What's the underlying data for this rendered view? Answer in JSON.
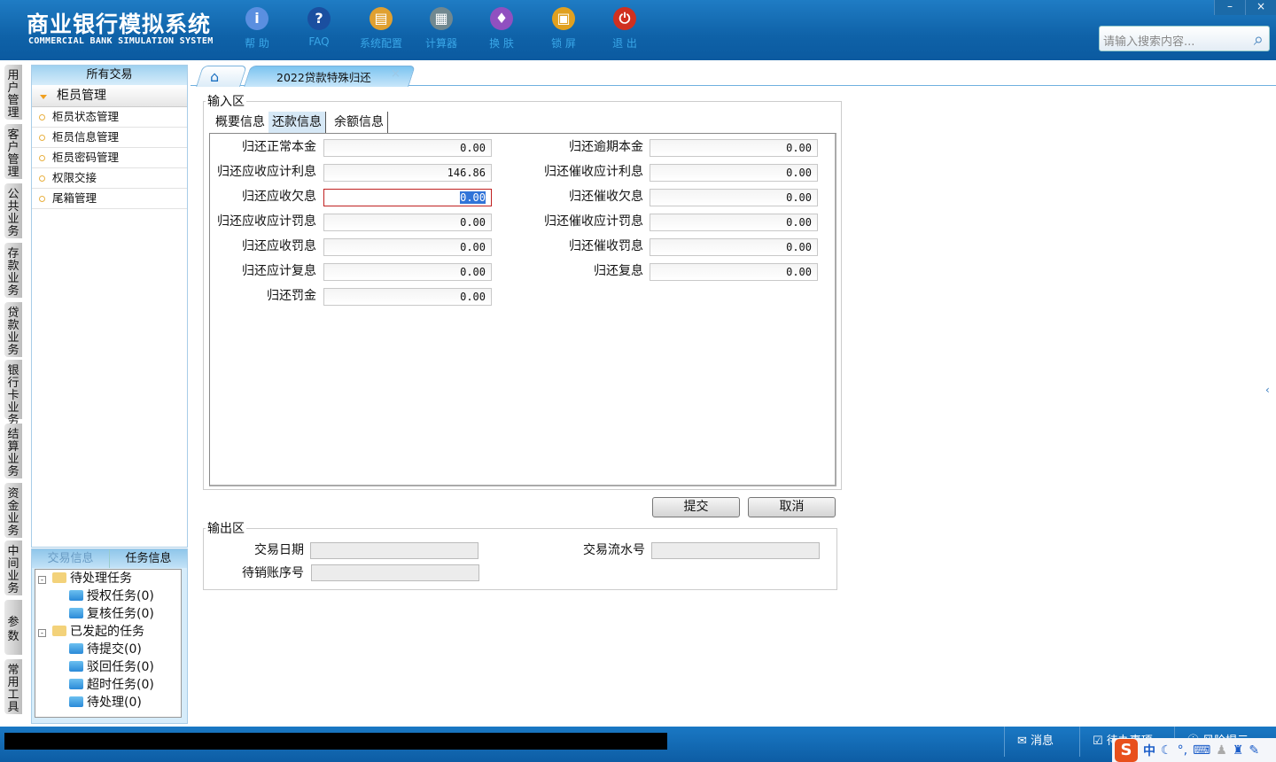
{
  "header": {
    "title": "商业银行模拟系统",
    "subtitle": "COMMERCIAL BANK SIMULATION SYSTEM",
    "tools": [
      {
        "label": "帮 助",
        "icon": "info-icon",
        "color": "#5a8fe0",
        "glyph": "i"
      },
      {
        "label": "FAQ",
        "icon": "help-icon",
        "color": "#1a4fa0",
        "glyph": "?"
      },
      {
        "label": "系统配置",
        "icon": "toolbox-icon",
        "color": "#e0a030",
        "glyph": "▤"
      },
      {
        "label": "计算器",
        "icon": "calculator-icon",
        "color": "#708890",
        "glyph": "▦"
      },
      {
        "label": "换 肤",
        "icon": "shirt-icon",
        "color": "#9050c0",
        "glyph": "♦"
      },
      {
        "label": "锁 屏",
        "icon": "lock-icon",
        "color": "#e0a020",
        "glyph": "▣"
      },
      {
        "label": "退 出",
        "icon": "power-icon",
        "color": "#d03020",
        "glyph": "⏻"
      }
    ],
    "search_placeholder": "请输入搜索内容...",
    "minimize": "–",
    "close": "×"
  },
  "vtabs": [
    "用户管理",
    "客户管理",
    "公共业务",
    "存款业务",
    "贷款业务",
    "银行卡业务",
    "结算业务",
    "资金业务",
    "中间业务",
    "参数",
    "常用工具"
  ],
  "sidebar": {
    "header": "所有交易",
    "group": "柜员管理",
    "items": [
      "柜员状态管理",
      "柜员信息管理",
      "柜员密码管理",
      "权限交接",
      "尾箱管理"
    ]
  },
  "taskpanel": {
    "tabs": [
      "交易信息",
      "任务信息"
    ],
    "tree": [
      {
        "label": "待处理任务",
        "children": [
          "授权任务(0)",
          "复核任务(0)"
        ]
      },
      {
        "label": "已发起的任务",
        "children": [
          "待提交(0)",
          "驳回任务(0)",
          "超时任务(0)",
          "待处理(0)"
        ]
      }
    ]
  },
  "tabs": {
    "active": "2022贷款特殊归还",
    "close": "×"
  },
  "input_area": {
    "legend": "输入区",
    "subtabs": [
      "概要信息",
      "还款信息",
      "余额信息"
    ],
    "left_fields": [
      {
        "label": "归还正常本金",
        "value": "0.00"
      },
      {
        "label": "归还应收应计利息",
        "value": "146.86"
      },
      {
        "label": "归还应收欠息",
        "value": "0.00"
      },
      {
        "label": "归还应收应计罚息",
        "value": "0.00"
      },
      {
        "label": "归还应收罚息",
        "value": "0.00"
      },
      {
        "label": "归还应计复息",
        "value": "0.00"
      },
      {
        "label": "归还罚金",
        "value": "0.00"
      }
    ],
    "right_fields": [
      {
        "label": "归还逾期本金",
        "value": "0.00"
      },
      {
        "label": "归还催收应计利息",
        "value": "0.00"
      },
      {
        "label": "归还催收欠息",
        "value": "0.00"
      },
      {
        "label": "归还催收应计罚息",
        "value": "0.00"
      },
      {
        "label": "归还催收罚息",
        "value": "0.00"
      },
      {
        "label": "归还复息",
        "value": "0.00"
      }
    ]
  },
  "buttons": {
    "submit": "提交",
    "cancel": "取消"
  },
  "output_area": {
    "legend": "输出区",
    "trade_date": "交易日期",
    "serial_no": "交易流水号",
    "writeoff_no": "待销账序号"
  },
  "statusbar": {
    "message": "消息",
    "todo": "待办事项",
    "risk": "风险提示"
  },
  "ime": {
    "logo": "S",
    "mode": "中",
    "punct": "°,"
  }
}
